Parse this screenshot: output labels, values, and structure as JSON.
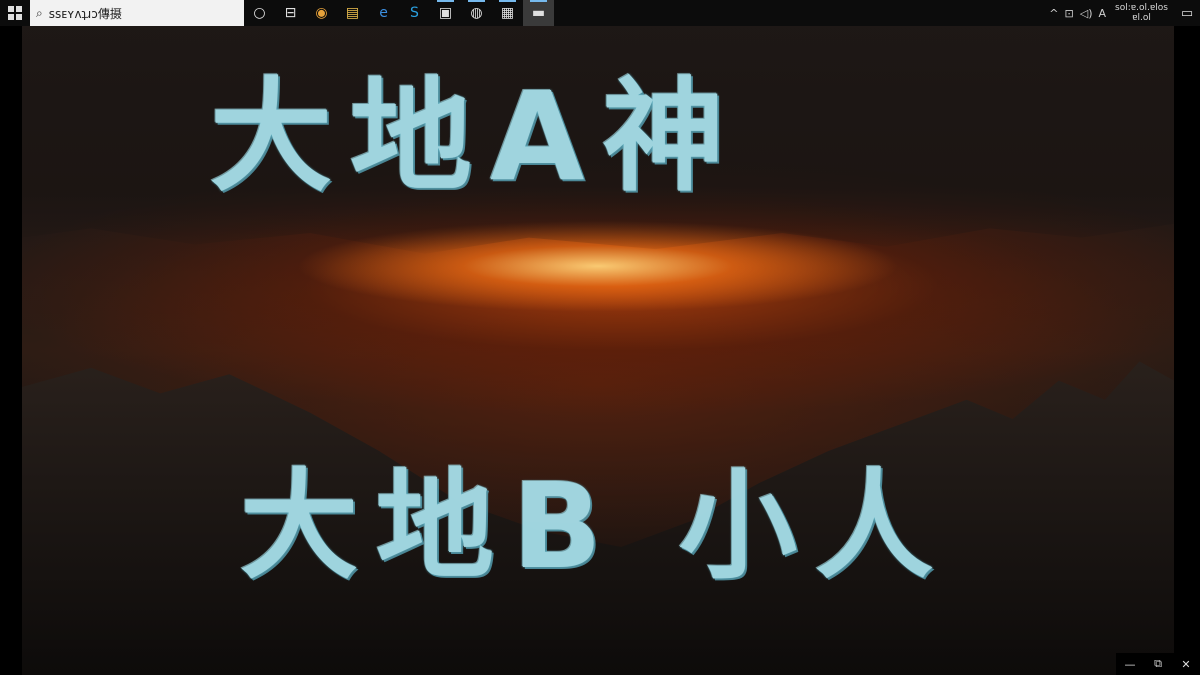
{
  "taskbar": {
    "search_text": "ssᴇʏʌʇɹɔ傳摄",
    "pinned": [
      {
        "name": "task-view",
        "glyph": "○"
      },
      {
        "name": "multitask",
        "glyph": "⊟"
      },
      {
        "name": "chrome",
        "glyph": "◉"
      },
      {
        "name": "file-explorer",
        "glyph": "▤"
      },
      {
        "name": "edge",
        "glyph": "e"
      },
      {
        "name": "skype",
        "glyph": "S"
      },
      {
        "name": "photos",
        "glyph": "▣"
      },
      {
        "name": "media",
        "glyph": "◍"
      },
      {
        "name": "notes",
        "glyph": "▦"
      },
      {
        "name": "video-player",
        "glyph": "▬"
      }
    ],
    "tray": {
      "chevron": "^",
      "items": [
        "⊡",
        "◁)",
        "A"
      ],
      "time": "sol:ɐ.ol.ɐlos",
      "date": "ɐl.ol",
      "notification_glyph": "▭"
    }
  },
  "video": {
    "line_1": "大地A神",
    "line_2": "大地B 小人"
  },
  "window_controls": {
    "minimize": "—",
    "restore": "⧉",
    "close": "✕"
  }
}
